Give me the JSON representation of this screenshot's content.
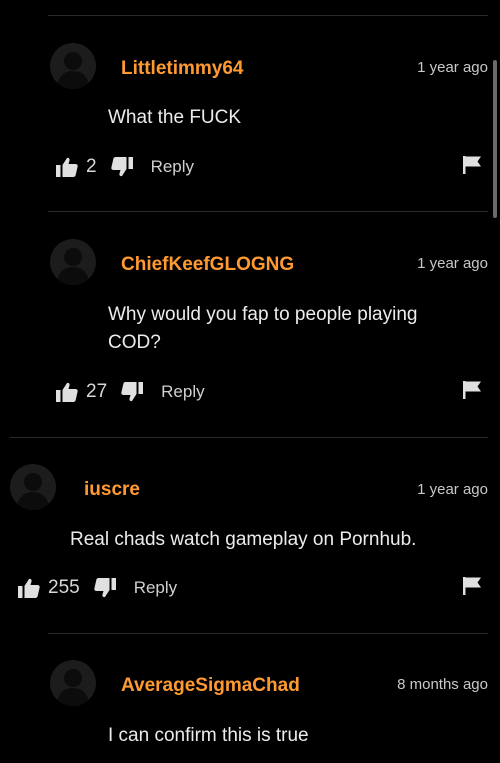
{
  "comments": [
    {
      "username": "Littletimmy64",
      "time": "1 year ago",
      "text": "What the FUCK",
      "likes": "2",
      "reply_label": "Reply"
    },
    {
      "username": "ChiefKeefGLOGNG",
      "time": "1 year ago",
      "text": "Why would you fap to people playing COD?",
      "likes": "27",
      "reply_label": "Reply"
    },
    {
      "username": "iuscre",
      "time": "1 year ago",
      "text": "Real chads watch gameplay on Pornhub.",
      "likes": "255",
      "reply_label": "Reply"
    },
    {
      "username": "AverageSigmaChad",
      "time": "8 months ago",
      "text": "I can confirm this is true"
    }
  ],
  "icons": {
    "like": "thumbs-up-icon",
    "dislike": "thumbs-down-icon",
    "flag": "flag-icon",
    "avatar": "user-silhouette-icon"
  },
  "colors": {
    "background": "#000000",
    "username": "#ff9a33",
    "text": "#ececec",
    "divider": "#2a2a2a"
  }
}
